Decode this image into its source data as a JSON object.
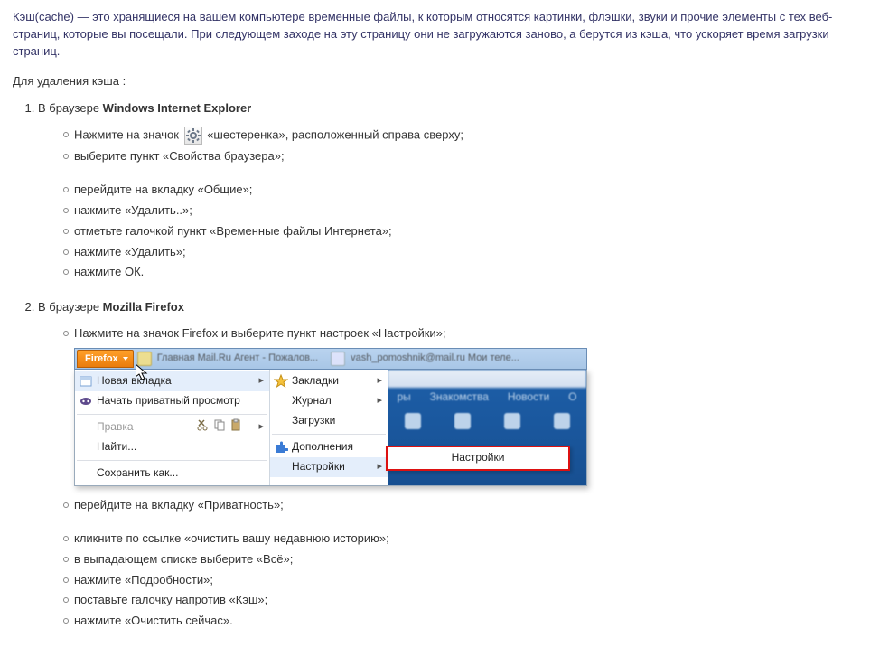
{
  "intro": "Кэш(cache) — это хранящиеся на вашем компьютере временные файлы, к которым относятся картинки, флэшки, звуки и прочие элементы с тех веб-страниц, которые вы посещали. При следующем заходе на эту страницу они не загружаются заново, а берутся из кэша, что ускоряет время загрузки страниц.",
  "subintro": "Для удаления кэша :",
  "browser1": {
    "prefix": "В браузере ",
    "name": "Windows Internet Explorer",
    "b_a": "Нажмите на значок ",
    "b_b": " «шестеренка», расположенный справа сверху;",
    "b2": "выберите пункт «Свойства браузера»;",
    "b3": "перейдите на вкладку «Общие»;",
    "b4": "нажмите «Удалить..»;",
    "b5": "отметьте галочкой пункт «Временные файлы Интернета»;",
    "b6": "нажмите «Удалить»;",
    "b7": "нажмите ОК."
  },
  "browser2": {
    "prefix": "В браузере ",
    "name": "Mozilla Firefox",
    "b1": "Нажмите на значок Firefox и выберите пункт настроек «Настройки»;",
    "b2": "перейдите на вкладку «Приватность»;",
    "b3": "кликните по ссылке «очистить вашу недавнюю историю»;",
    "b4": "в выпадающем списке выберите «Всё»;",
    "b5": "нажмите «Подробности»;",
    "b6": "поставьте галочку напротив «Кэш»;",
    "b7": "нажмите «Очистить сейчас»."
  },
  "ffmenu": {
    "button": "Firefox",
    "tab_blur1": "Главная Mail.Ru Агент - Пожалов...",
    "tab_blur2": "vash_pomoshnik@mail.ru Мои теле...",
    "left": {
      "new_tab": "Новая вкладка",
      "private": "Начать приватный просмотр",
      "edit": "Правка",
      "find": "Найти...",
      "save_as": "Сохранить как..."
    },
    "right": {
      "bookmarks": "Закладки",
      "history": "Журнал",
      "downloads": "Загрузки",
      "addons": "Дополнения",
      "settings": "Настройки"
    },
    "popup": "Настройки",
    "bg": {
      "t1": "ры",
      "t2": "Знакомства",
      "t3": "Новости",
      "t4": "O"
    }
  }
}
